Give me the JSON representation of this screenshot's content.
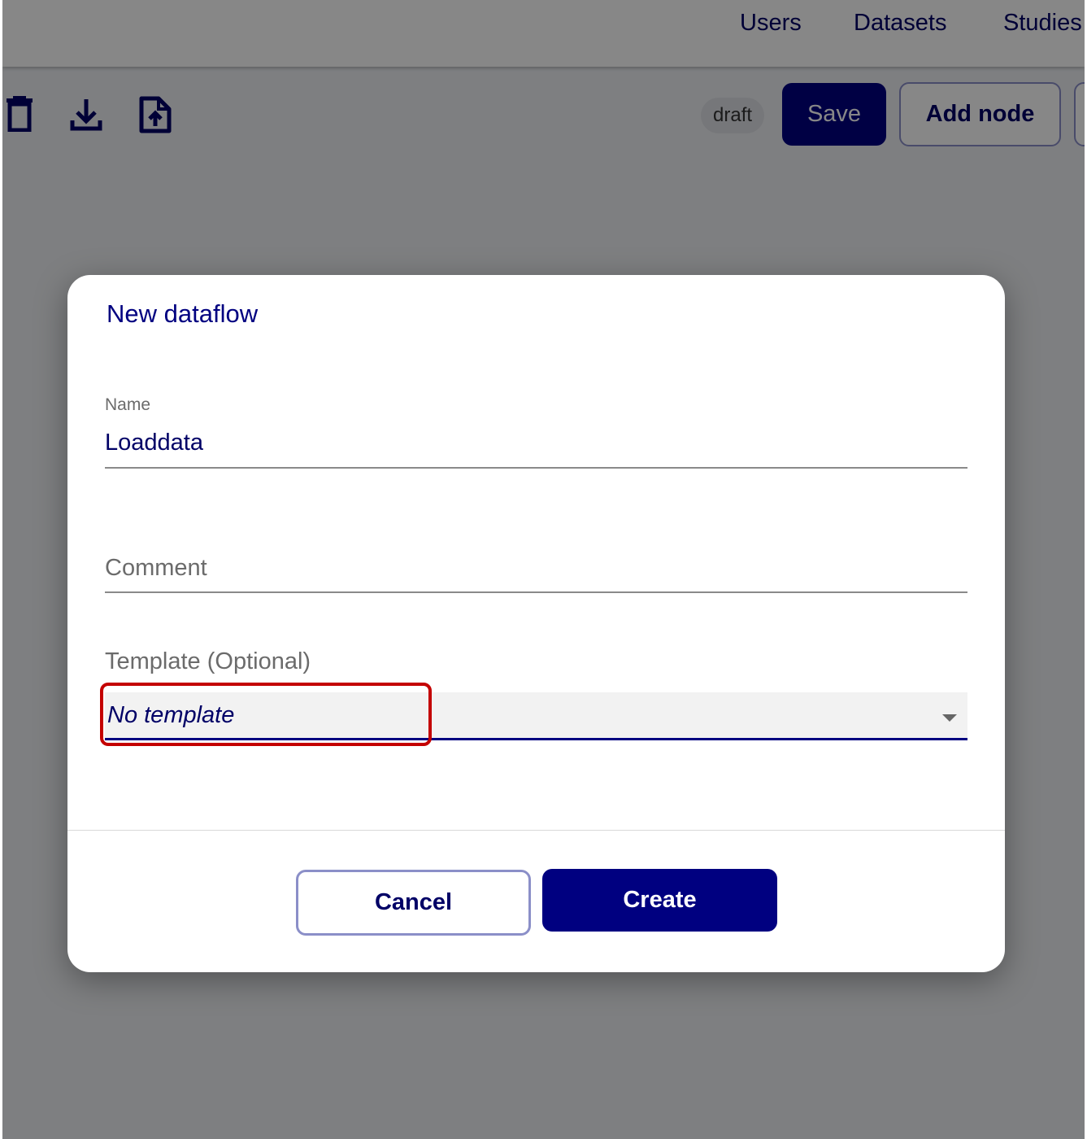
{
  "nav": {
    "links": [
      "Users",
      "Datasets",
      "Studies"
    ]
  },
  "toolbar": {
    "icons": [
      "trash-icon",
      "download-icon",
      "file-upload-icon"
    ],
    "status_badge": "draft",
    "save_label": "Save",
    "add_node_label": "Add node"
  },
  "dialog": {
    "title": "New dataflow",
    "name": {
      "label": "Name",
      "value": "Loaddata"
    },
    "comment": {
      "placeholder": "Comment",
      "value": ""
    },
    "template": {
      "label": "Template (Optional)",
      "selected": "No template"
    },
    "cancel_label": "Cancel",
    "create_label": "Create"
  },
  "colors": {
    "primary": "#000080",
    "highlight": "#c40000",
    "overlay": "#7a7a7a"
  }
}
